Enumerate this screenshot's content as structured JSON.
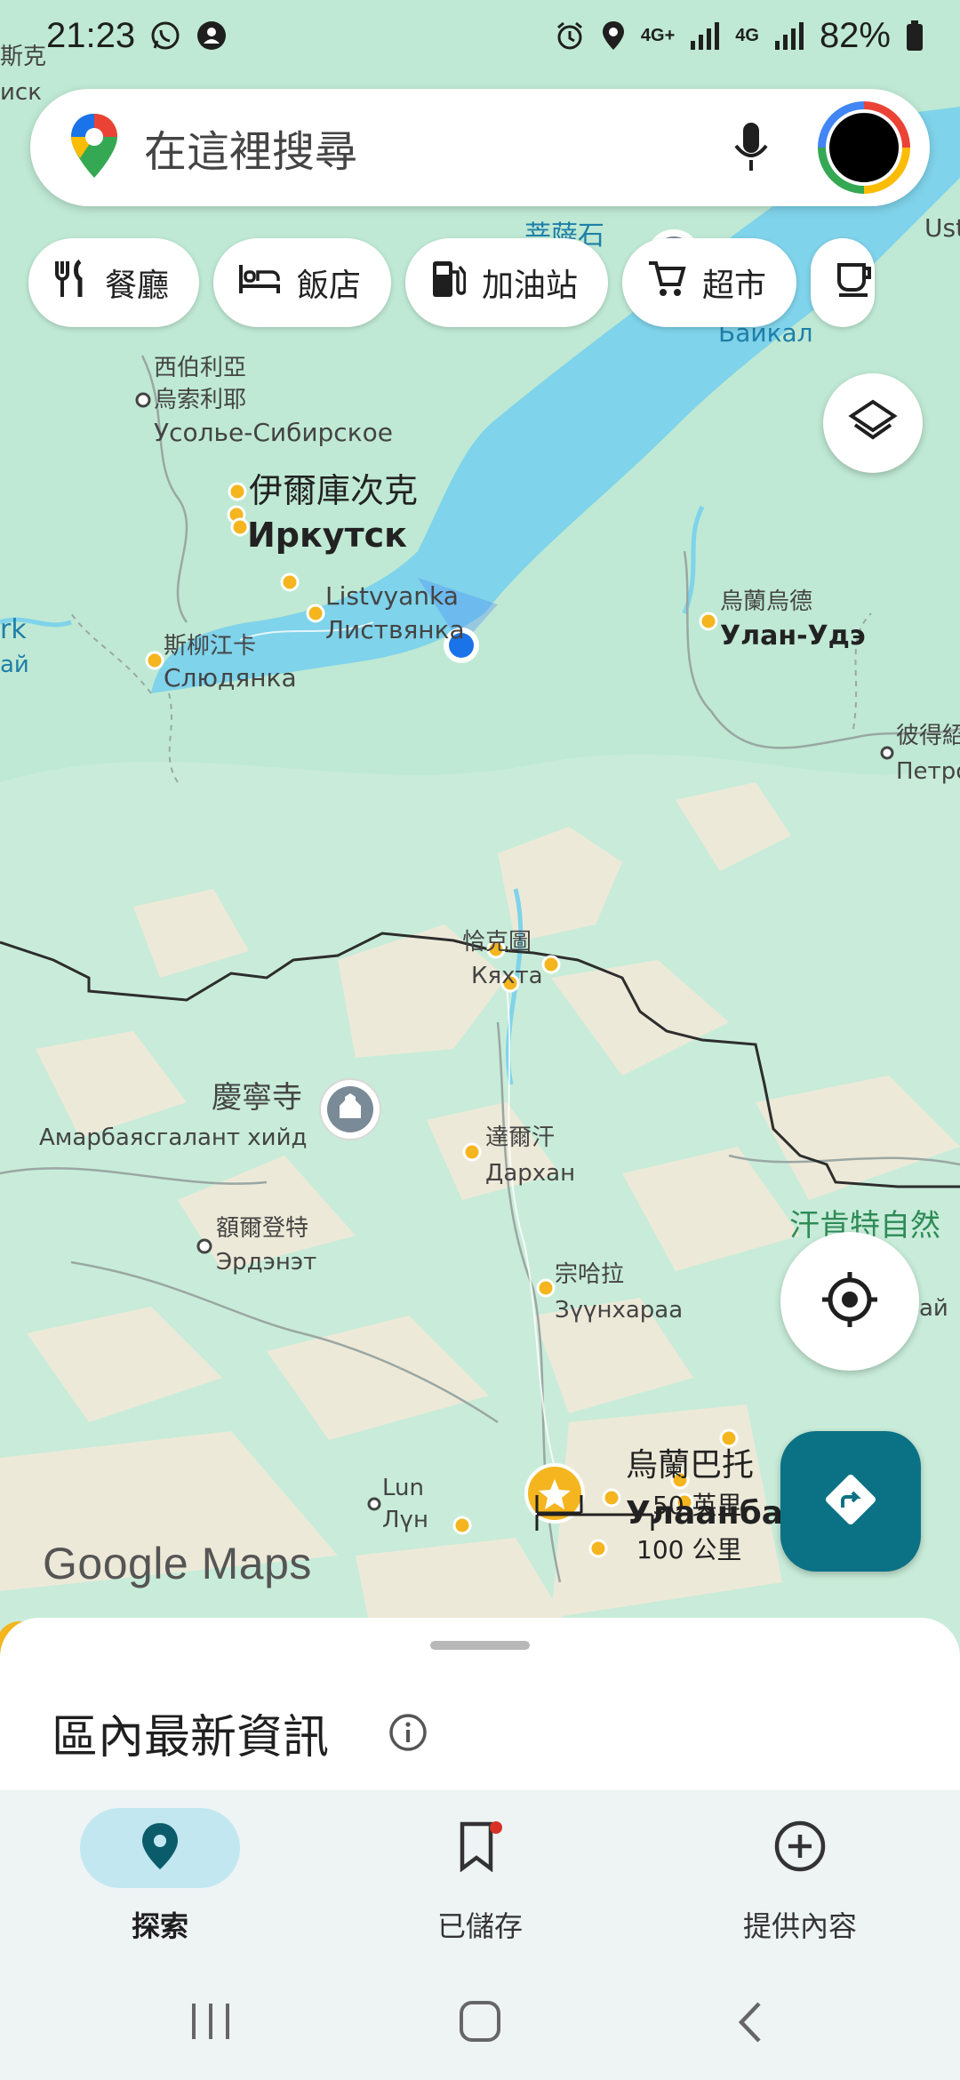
{
  "status_bar": {
    "time": "21:23",
    "battery": "82%",
    "net1": "4G+",
    "net2": "4G"
  },
  "search": {
    "placeholder": "在這裡搜尋"
  },
  "chips": [
    {
      "label": "餐廳",
      "icon": "restaurant-icon"
    },
    {
      "label": "飯店",
      "icon": "hotel-icon"
    },
    {
      "label": "加油站",
      "icon": "gas-station-icon"
    },
    {
      "label": "超市",
      "icon": "cart-icon"
    }
  ],
  "map": {
    "labels": {
      "partial_tl1": "斯克",
      "partial_tl2": "иск",
      "usolye_zh1": "西伯利亞",
      "usolye_zh2": "烏索利耶",
      "usolye_ru": "Усолье-Сибирское",
      "irkutsk_zh": "伊爾庫次克",
      "irkutsk_ru": "Иркутск",
      "listvyanka_en": "Listvyanka",
      "listvyanka_ru": "Листвянка",
      "slyudyanka_zh": "斯柳江卡",
      "slyudyanka_ru": "Слюдянка",
      "ulanude_zh": "烏蘭烏德",
      "ulanude_ru": "Улан-Удэ",
      "petro_zh": "彼得紹",
      "petro_ru": "Петро",
      "baikal_ru": "Байкал",
      "top_partial": "菩薩石",
      "ust": "Ust",
      "kyakhta_zh": "恰克圖",
      "kyakhta_ru": "Кяхта",
      "monastery_zh": "慶寧寺",
      "monastery_ru": "Амарбаясгалант хийд",
      "darkhan_zh": "達爾汗",
      "darkhan_ru": "Дархан",
      "erdenet_zh": "額爾登特",
      "erdenet_ru": "Эрдэнэт",
      "zuunkharaa_zh": "宗哈拉",
      "zuunkharaa_ru": "Зүүнхараа",
      "park_zh": "汗肯特自然",
      "lun_en": "Lun",
      "lun_ru": "Лүн",
      "ulaanbaatar_zh": "烏蘭巴托",
      "ulaanbaatar_ru": "Улаанбаа",
      "left_partial1": "rk",
      "left_partial2": "ай",
      "right_partial": "ай"
    }
  },
  "watermark": "Google Maps",
  "scale": {
    "miles": "50 英里",
    "km": "100 公里"
  },
  "sheet": {
    "title": "區內最新資訊"
  },
  "bottom_nav": [
    {
      "label": "探索",
      "icon": "explore-pin-icon",
      "active": true
    },
    {
      "label": "已儲存",
      "icon": "bookmark-icon",
      "active": false
    },
    {
      "label": "提供內容",
      "icon": "add-circle-icon",
      "active": false
    }
  ],
  "colors": {
    "accent": "#0b7285",
    "lake": "#7fd3ea",
    "land": "#bfe9d4",
    "active_pill": "#c2e7f0"
  }
}
